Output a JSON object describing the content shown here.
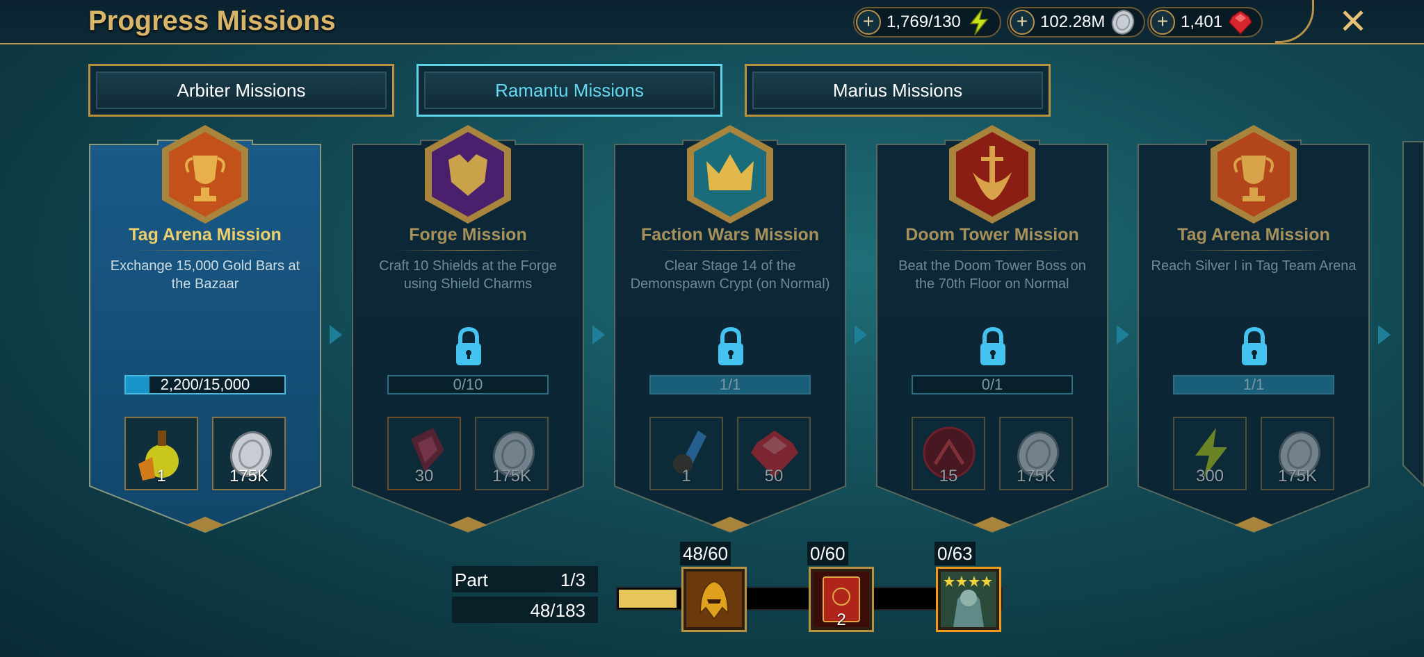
{
  "header": {
    "title": "Progress Missions",
    "energy": "1,769/130",
    "silver": "102.28M",
    "gems": "1,401",
    "close_label": "✕"
  },
  "tabs": [
    {
      "label": "Arbiter Missions",
      "active": false
    },
    {
      "label": "Ramantu Missions",
      "active": true
    },
    {
      "label": "Marius Missions",
      "active": false
    }
  ],
  "cards": [
    {
      "title": "Tag Arena Mission",
      "desc": "Exchange 15,000 Gold Bars at the Bazaar",
      "progress": "2,200/15,000",
      "fraction": 0.1467,
      "locked": false,
      "rewards": [
        "1",
        "175K"
      ]
    },
    {
      "title": "Forge Mission",
      "desc": "Craft 10 Shields at the Forge using Shield Charms",
      "progress": "0/10",
      "fraction": 0,
      "locked": true,
      "rewards": [
        "30",
        "175K"
      ]
    },
    {
      "title": "Faction Wars Mission",
      "desc": "Clear Stage 14 of the Demonspawn Crypt (on Normal)",
      "progress": "1/1",
      "fraction": 1,
      "locked": true,
      "rewards": [
        "1",
        "50"
      ]
    },
    {
      "title": "Doom Tower Mission",
      "desc": "Beat the Doom Tower Boss on the 70th Floor on Normal",
      "progress": "0/1",
      "fraction": 0,
      "locked": true,
      "rewards": [
        "15",
        "175K"
      ]
    },
    {
      "title": "Tag Arena Mission",
      "desc": "Reach Silver I in Tag Team Arena",
      "progress": "1/1",
      "fraction": 1,
      "locked": true,
      "rewards": [
        "300",
        "175K"
      ]
    }
  ],
  "part": {
    "label": "Part",
    "part_value": "1/3",
    "points": "48/183",
    "fraction": 0.262
  },
  "milestones": [
    {
      "label": "48/60"
    },
    {
      "label": "0/60",
      "count": "2"
    },
    {
      "label": "0/63"
    }
  ]
}
